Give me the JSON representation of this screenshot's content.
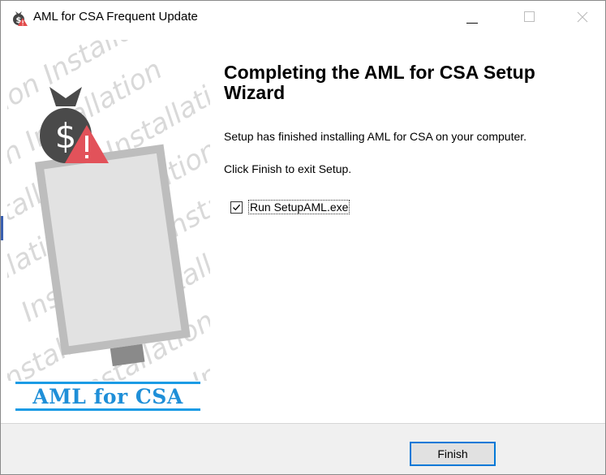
{
  "window": {
    "title": "AML for CSA Frequent Update",
    "icon": "money-bag-warning-icon"
  },
  "titlebar_buttons": {
    "minimize_icon": "minimize-icon",
    "maximize_icon": "maximize-icon",
    "close_icon": "close-icon"
  },
  "banner": {
    "watermark_word": "Installation",
    "brand": "AML for CSA",
    "brand_color": "#1f8fd8"
  },
  "content": {
    "heading": "Completing the AML for CSA Setup Wizard",
    "line1": "Setup has finished installing AML for CSA on your computer.",
    "line2": "Click Finish to exit Setup.",
    "run_checkbox": {
      "label": "Run SetupAML.exe",
      "checked": true
    }
  },
  "footer": {
    "finish_label": "Finish",
    "accent": "#0078d7"
  }
}
